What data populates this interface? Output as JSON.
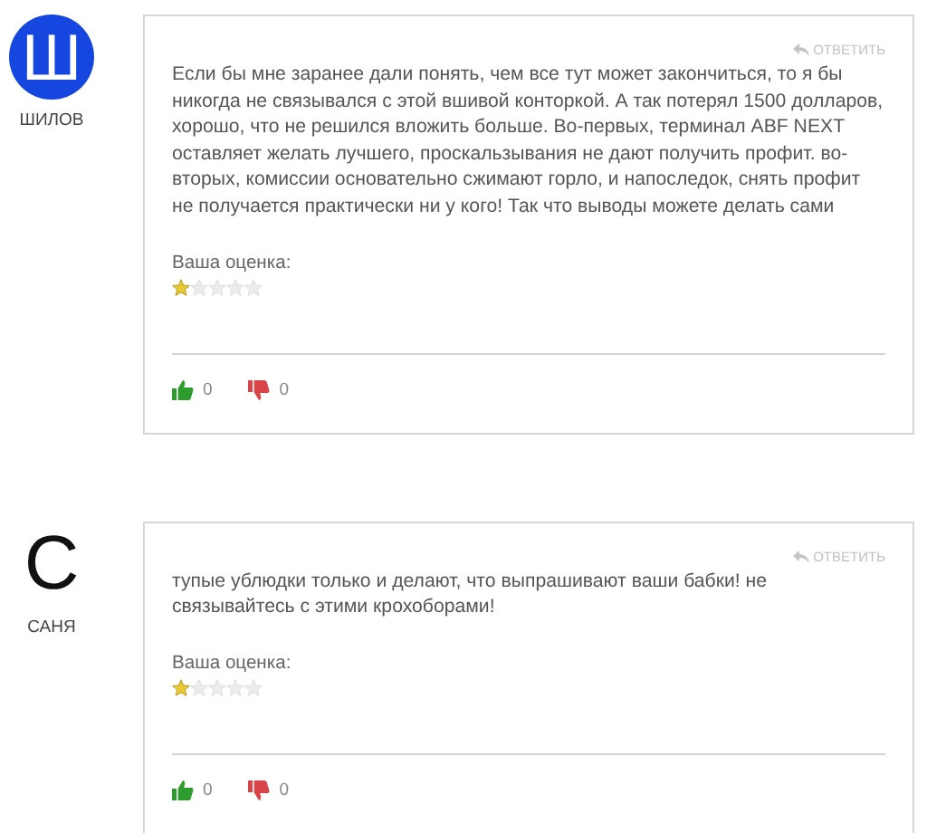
{
  "comments": [
    {
      "avatar": {
        "letter": "Ш",
        "kind": "circle"
      },
      "author": "ШИЛОВ",
      "reply": "ОТВЕТИТЬ",
      "text": "Если бы мне заранее дали понять, чем все тут может закончиться, то я бы никогда не связывался с этой вшивой конторкой. А так потерял 1500 долларов, хорошо, что не решился вложить больше. Во-первых, терминал ABF NEXT оставляет желать лучшего, проскальзывания не дают получить профит. во-вторых, комиссии основательно сжимают горло, и напоследок, снять профит не получается практически ни у кого! Так что выводы можете делать сами",
      "rating_label": "Ваша оценка:",
      "stars": 1,
      "likes": "0",
      "dislikes": "0"
    },
    {
      "avatar": {
        "letter": "С",
        "kind": "plain"
      },
      "author": "САНЯ",
      "reply": "ОТВЕТИТЬ",
      "text": "тупые ублюдки только и делают, что выпрашивают ваши бабки! не связывайтесь с этими крохоборами!",
      "rating_label": "Ваша оценка:",
      "stars": 1,
      "likes": "0",
      "dislikes": "0"
    }
  ]
}
